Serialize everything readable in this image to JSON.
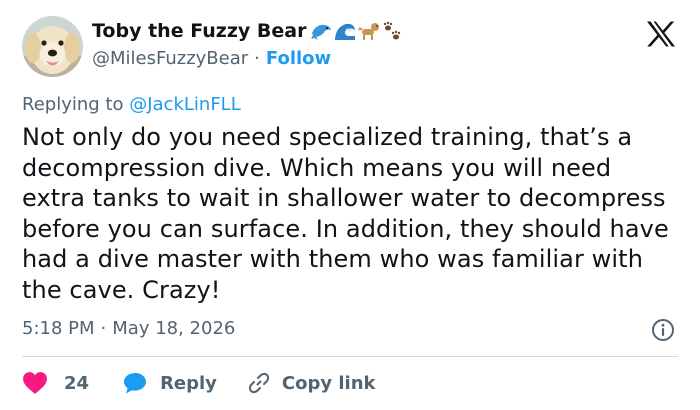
{
  "author": {
    "display_name": "Toby the Fuzzy Bear",
    "emojis": [
      "dolphin-emoji",
      "wave-emoji",
      "dog-emoji",
      "paw-prints-emoji"
    ],
    "handle": "@MilesFuzzyBear",
    "separator": "·",
    "follow_label": "Follow"
  },
  "reply_context": {
    "prefix": "Replying to",
    "mention": "@JackLinFLL"
  },
  "tweet": {
    "text": "Not only do you need specialized training, that’s a decompression dive. Which means you will need extra tanks to wait in shallower water to decompress before you can surface. In addition, they should have had a dive master with them who was familiar with the cave. Crazy!",
    "time": "5:18 PM",
    "separator": "·",
    "date": "May 18, 2026"
  },
  "actions": {
    "like_count": "24",
    "reply_label": "Reply",
    "copy_link_label": "Copy link"
  },
  "colors": {
    "accent": "#1d9bf0",
    "like": "#f91880",
    "muted": "#536471",
    "text": "#0f1419"
  }
}
